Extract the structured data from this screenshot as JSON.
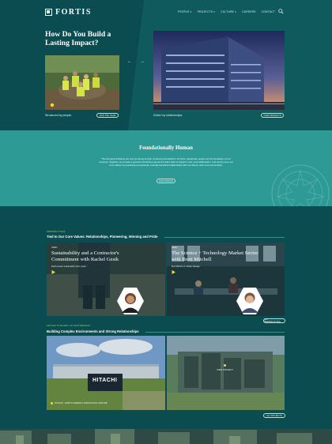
{
  "brand": {
    "name": "FORTIS"
  },
  "nav": {
    "items": [
      "PEOPLE ▾",
      "PROJECTS ▾",
      "CULTURE ▾",
      "CAREERS",
      "CONTACT"
    ]
  },
  "hero": {
    "title": "How Do You Build a Lasting Impact?",
    "caption_left": "Structured by people.",
    "caption_right": "Driven by relationships.",
    "btn_left": "JOIN THE TEAM",
    "btn_right": "VIEW PROJECTS",
    "arrow_prev": "←",
    "arrow_next": "→"
  },
  "band": {
    "title": "Foundationally Human",
    "body": "The strongest buildings are only as strong as their underlying foundations. At Fortis, passionate people are the foundation of our company. Together, we provide a general contracting experience that's built on support, trust, and collaboration, and we live up to our Core Values by developing exceptional, mutually beneficial relationships with our clients, staff, and communities.",
    "button": "OUR MISSION"
  },
  "perspectives": {
    "eyebrow": "PERSPECTIVES",
    "title": "Tied to Our Core Values: Relationships, Pioneering, Winning and Pride",
    "all_button": "ALL PERSPECTIVES",
    "cards": [
      {
        "tag": "VIDEO",
        "title": "Sustainability and a Contractor's Commitment with Rachel Gesik",
        "meta": "Rachel Gesik, Sustainability Team Leader"
      },
      {
        "tag": "VIDEO",
        "title": "The Science + Technology Market Sector with Brett Mitchell",
        "meta": "Brett Mitchell, Sr. Market Manager"
      }
    ]
  },
  "projects": {
    "eyebrow": "PROJECTS BASED ON PARTNERSHIP",
    "title": "Building Complex Environments and Strong Relationships",
    "all_button": "ALL PROJECTS",
    "items": [
      {
        "label": "HITACHI, NORTH AMERICA INNOVATION CENTER",
        "sign": "HITACHI"
      },
      {
        "label": "VIEW PROJECT"
      }
    ]
  },
  "colors": {
    "hero_bg": "#0a4c50",
    "band_bg": "#2d9a96",
    "lower_bg": "#0b4c50",
    "accent_green": "#a9d86b",
    "accent_yellow": "#f2dc2a"
  }
}
